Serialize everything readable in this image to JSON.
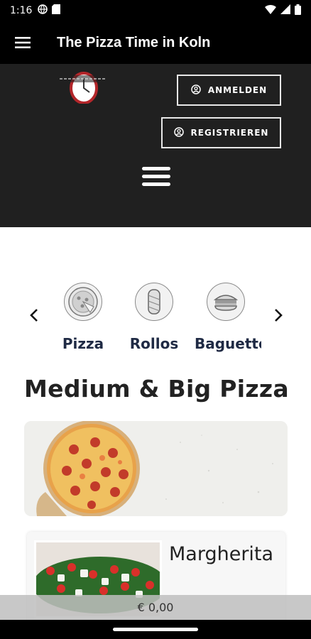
{
  "status_bar": {
    "time": "1:16",
    "icons": [
      "globe-icon",
      "sd-card-icon",
      "wifi-icon",
      "signal-icon",
      "battery-icon"
    ]
  },
  "app_bar": {
    "title": "The Pizza Time in Koln",
    "menu_icon": "hamburger-menu-icon"
  },
  "header": {
    "logo_icon": "pizza-time-logo",
    "login_label": "ANMELDEN",
    "register_label": "REGISTRIEREN",
    "menu_icon": "hamburger-menu-icon"
  },
  "categories": {
    "items": [
      {
        "label": "Pizza",
        "icon": "pizza-icon"
      },
      {
        "label": "Rollos",
        "icon": "wrap-icon"
      },
      {
        "label": "Baguette",
        "icon": "sandwich-icon"
      }
    ],
    "prev_icon": "chevron-left-icon",
    "next_icon": "chevron-right-icon"
  },
  "section": {
    "title": "Medium & Big Pizza"
  },
  "products": [
    {
      "name": "Margherita"
    }
  ],
  "cart": {
    "total": "€ 0,00"
  },
  "colors": {
    "appbar": "#000000",
    "header": "#202020",
    "category_text": "#1f2a44",
    "cart_bar": "#bebebe"
  }
}
